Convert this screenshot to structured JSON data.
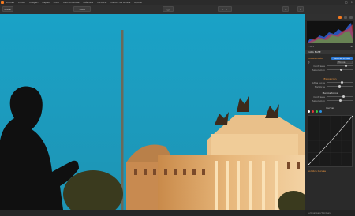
{
  "menu": {
    "items": [
      "Archivo",
      "Editar",
      "Imagen",
      "Capas",
      "Filtro",
      "Herramientas",
      "Máscara",
      "Ventana",
      "Centro de Ayuda",
      "Ayuda"
    ]
  },
  "toolbar": {
    "view_label": "Editar",
    "zoom_label": "Vista",
    "mode_label": "—"
  },
  "panel": {
    "tabs": [
      "adjust",
      "layers",
      "history"
    ],
    "histogram_label": "Luma",
    "channel_value": "Todos",
    "section_title": "CAPA BASE",
    "section2_title": "CORRECCIÓN",
    "preset_button": "Buscar Preset",
    "tone_header": "Exposición",
    "highlights": "Altas luces",
    "shadows": "Sombras",
    "midtones": "Medios tonos",
    "contrast": "Contraste",
    "saturation": "Saturación",
    "curves_title": "Curvas",
    "footer_section": "Sombra Curvas",
    "footer_tip": "Luminar para Windows"
  },
  "colors": {
    "accent": "#f47a20",
    "sky": "#1d9cc0",
    "panel_bg": "#2a2a2a"
  }
}
